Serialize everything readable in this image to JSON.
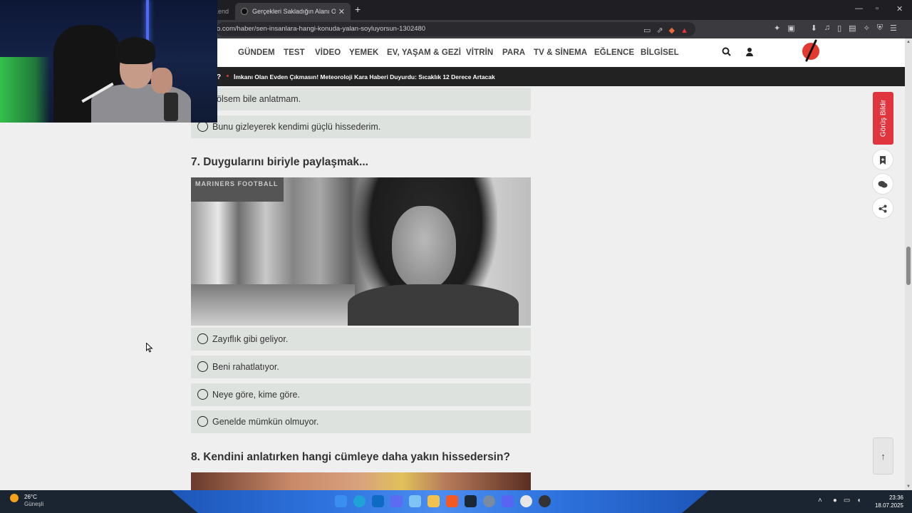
{
  "browser": {
    "prev_tab_fragment": "Kend",
    "active_tab_title": "Gerçekleri Sakladığın Alanı Ortay",
    "url": "o.com/haber/sen-insanlara-hangi-konuda-yalan-soyluyorsun-1302480"
  },
  "nav": {
    "items": [
      "GÜNDEM",
      "TEST",
      "VİDEO",
      "YEMEK",
      "EV, YAŞAM & GEZİ",
      "VİTRİN",
      "PARA",
      "TV & SİNEMA",
      "EĞLENCE",
      "BİLGİSEL"
    ]
  },
  "ticker": {
    "prefix": "?",
    "headline": "İmkanı Olan Evden Çıkmasın! Meteoroloji Kara Haberi Duyurdu: Sıcaklık 12 Derece Artacak"
  },
  "prev_options": [
    "ölsem bile anlatmam.",
    "Bunu gizleyerek kendimi güçlü hissederim."
  ],
  "question7": {
    "title": "7. Duygularını biriyle paylaşmak...",
    "image_banner": "MARINERS FOOTBALL",
    "options": [
      "Zayıflık gibi geliyor.",
      "Beni rahatlatıyor.",
      "Neye göre, kime göre.",
      "Genelde mümkün olmuyor."
    ]
  },
  "question8": {
    "title": "8. Kendini anlatırken hangi cümleye daha yakın hissedersin?"
  },
  "sidebar": {
    "feedback_label": "Görüş Bildir"
  },
  "taskbar": {
    "weather_temp": "26°C",
    "weather_cond": "Güneşli",
    "time": "23:36",
    "date": "18.07.2025"
  },
  "colors": {
    "accent_red": "#e0343f",
    "option_bg": "#dde2df",
    "ticker_bg": "#222222"
  }
}
